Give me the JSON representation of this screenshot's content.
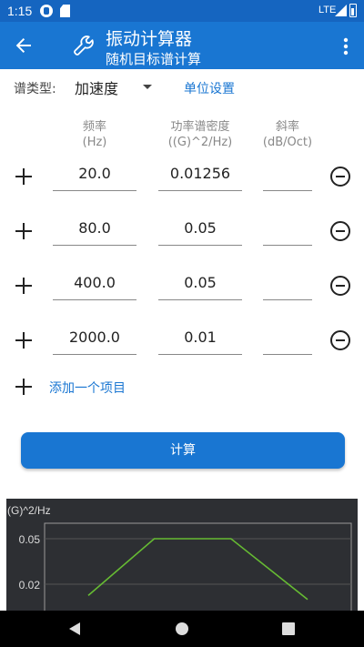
{
  "status": {
    "time": "1:15",
    "network": "LTE"
  },
  "appbar": {
    "title": "振动计算器",
    "subtitle": "随机目标谱计算"
  },
  "spectrum_type": {
    "label": "谱类型:",
    "value": "加速度",
    "unit_settings": "单位设置"
  },
  "columns": [
    {
      "name": "频率",
      "unit": "(Hz)"
    },
    {
      "name": "功率谱密度",
      "unit": "((G)^2/Hz)"
    },
    {
      "name": "斜率",
      "unit": "(dB/Oct)"
    }
  ],
  "rows": [
    {
      "freq": "20.0",
      "psd": "0.01256",
      "slope": ""
    },
    {
      "freq": "80.0",
      "psd": "0.05",
      "slope": ""
    },
    {
      "freq": "400.0",
      "psd": "0.05",
      "slope": ""
    },
    {
      "freq": "2000.0",
      "psd": "0.01",
      "slope": ""
    }
  ],
  "add_item_label": "添加一个项目",
  "calculate_label": "计算",
  "chart_data": {
    "type": "line",
    "ylabel": "(G)^2/Hz",
    "yticks": [
      "0.05",
      "0.02"
    ],
    "x": [
      20,
      80,
      400,
      2000
    ],
    "y": [
      0.01256,
      0.05,
      0.05,
      0.01
    ],
    "xscale": "log",
    "colors": {
      "background": "#2d2f33",
      "line": "#66bb33",
      "axis": "#9a9a9a"
    }
  },
  "colors": {
    "primary": "#1976d2",
    "status_bar": "#1565c0"
  }
}
